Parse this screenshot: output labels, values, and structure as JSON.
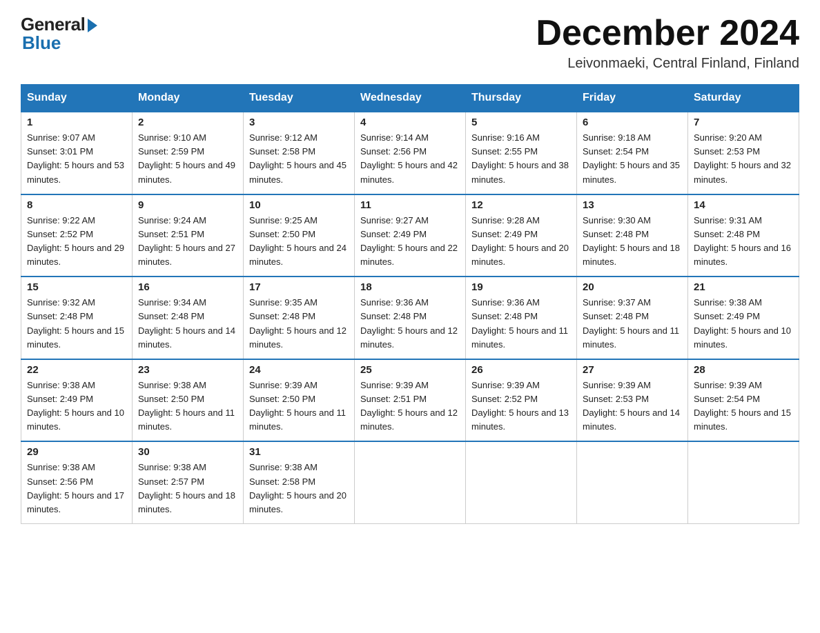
{
  "logo": {
    "general": "General",
    "blue": "Blue"
  },
  "title": "December 2024",
  "location": "Leivonmaeki, Central Finland, Finland",
  "days_of_week": [
    "Sunday",
    "Monday",
    "Tuesday",
    "Wednesday",
    "Thursday",
    "Friday",
    "Saturday"
  ],
  "weeks": [
    [
      {
        "day": "1",
        "sunrise": "9:07 AM",
        "sunset": "3:01 PM",
        "daylight": "5 hours and 53 minutes."
      },
      {
        "day": "2",
        "sunrise": "9:10 AM",
        "sunset": "2:59 PM",
        "daylight": "5 hours and 49 minutes."
      },
      {
        "day": "3",
        "sunrise": "9:12 AM",
        "sunset": "2:58 PM",
        "daylight": "5 hours and 45 minutes."
      },
      {
        "day": "4",
        "sunrise": "9:14 AM",
        "sunset": "2:56 PM",
        "daylight": "5 hours and 42 minutes."
      },
      {
        "day": "5",
        "sunrise": "9:16 AM",
        "sunset": "2:55 PM",
        "daylight": "5 hours and 38 minutes."
      },
      {
        "day": "6",
        "sunrise": "9:18 AM",
        "sunset": "2:54 PM",
        "daylight": "5 hours and 35 minutes."
      },
      {
        "day": "7",
        "sunrise": "9:20 AM",
        "sunset": "2:53 PM",
        "daylight": "5 hours and 32 minutes."
      }
    ],
    [
      {
        "day": "8",
        "sunrise": "9:22 AM",
        "sunset": "2:52 PM",
        "daylight": "5 hours and 29 minutes."
      },
      {
        "day": "9",
        "sunrise": "9:24 AM",
        "sunset": "2:51 PM",
        "daylight": "5 hours and 27 minutes."
      },
      {
        "day": "10",
        "sunrise": "9:25 AM",
        "sunset": "2:50 PM",
        "daylight": "5 hours and 24 minutes."
      },
      {
        "day": "11",
        "sunrise": "9:27 AM",
        "sunset": "2:49 PM",
        "daylight": "5 hours and 22 minutes."
      },
      {
        "day": "12",
        "sunrise": "9:28 AM",
        "sunset": "2:49 PM",
        "daylight": "5 hours and 20 minutes."
      },
      {
        "day": "13",
        "sunrise": "9:30 AM",
        "sunset": "2:48 PM",
        "daylight": "5 hours and 18 minutes."
      },
      {
        "day": "14",
        "sunrise": "9:31 AM",
        "sunset": "2:48 PM",
        "daylight": "5 hours and 16 minutes."
      }
    ],
    [
      {
        "day": "15",
        "sunrise": "9:32 AM",
        "sunset": "2:48 PM",
        "daylight": "5 hours and 15 minutes."
      },
      {
        "day": "16",
        "sunrise": "9:34 AM",
        "sunset": "2:48 PM",
        "daylight": "5 hours and 14 minutes."
      },
      {
        "day": "17",
        "sunrise": "9:35 AM",
        "sunset": "2:48 PM",
        "daylight": "5 hours and 12 minutes."
      },
      {
        "day": "18",
        "sunrise": "9:36 AM",
        "sunset": "2:48 PM",
        "daylight": "5 hours and 12 minutes."
      },
      {
        "day": "19",
        "sunrise": "9:36 AM",
        "sunset": "2:48 PM",
        "daylight": "5 hours and 11 minutes."
      },
      {
        "day": "20",
        "sunrise": "9:37 AM",
        "sunset": "2:48 PM",
        "daylight": "5 hours and 11 minutes."
      },
      {
        "day": "21",
        "sunrise": "9:38 AM",
        "sunset": "2:49 PM",
        "daylight": "5 hours and 10 minutes."
      }
    ],
    [
      {
        "day": "22",
        "sunrise": "9:38 AM",
        "sunset": "2:49 PM",
        "daylight": "5 hours and 10 minutes."
      },
      {
        "day": "23",
        "sunrise": "9:38 AM",
        "sunset": "2:50 PM",
        "daylight": "5 hours and 11 minutes."
      },
      {
        "day": "24",
        "sunrise": "9:39 AM",
        "sunset": "2:50 PM",
        "daylight": "5 hours and 11 minutes."
      },
      {
        "day": "25",
        "sunrise": "9:39 AM",
        "sunset": "2:51 PM",
        "daylight": "5 hours and 12 minutes."
      },
      {
        "day": "26",
        "sunrise": "9:39 AM",
        "sunset": "2:52 PM",
        "daylight": "5 hours and 13 minutes."
      },
      {
        "day": "27",
        "sunrise": "9:39 AM",
        "sunset": "2:53 PM",
        "daylight": "5 hours and 14 minutes."
      },
      {
        "day": "28",
        "sunrise": "9:39 AM",
        "sunset": "2:54 PM",
        "daylight": "5 hours and 15 minutes."
      }
    ],
    [
      {
        "day": "29",
        "sunrise": "9:38 AM",
        "sunset": "2:56 PM",
        "daylight": "5 hours and 17 minutes."
      },
      {
        "day": "30",
        "sunrise": "9:38 AM",
        "sunset": "2:57 PM",
        "daylight": "5 hours and 18 minutes."
      },
      {
        "day": "31",
        "sunrise": "9:38 AM",
        "sunset": "2:58 PM",
        "daylight": "5 hours and 20 minutes."
      },
      null,
      null,
      null,
      null
    ]
  ]
}
